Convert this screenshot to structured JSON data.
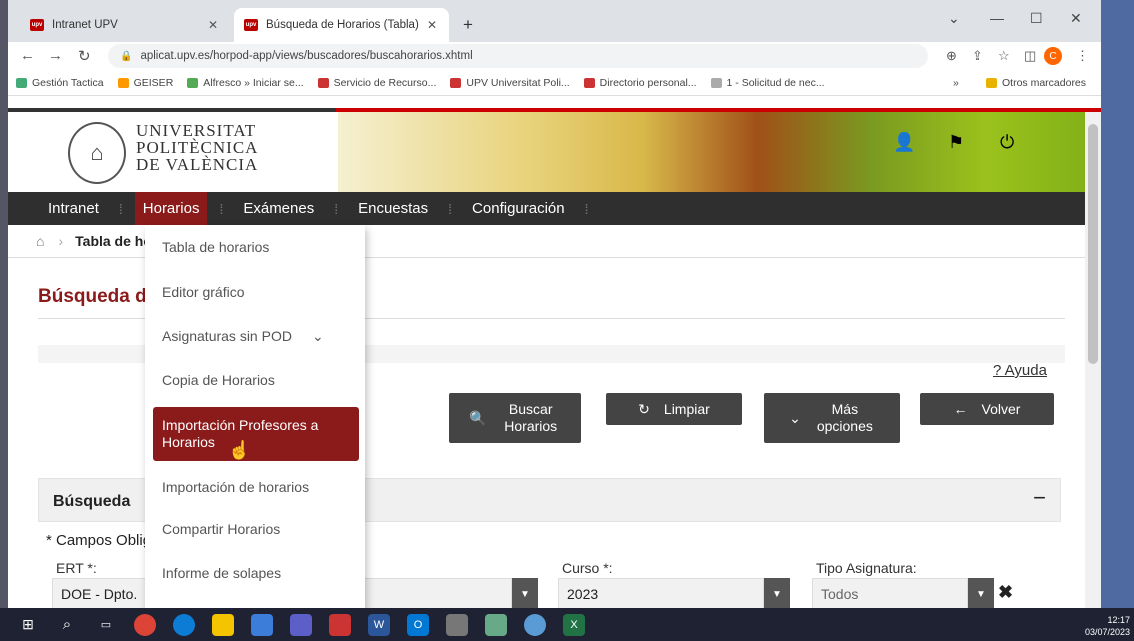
{
  "browser": {
    "tabs": [
      {
        "label": "Intranet UPV"
      },
      {
        "label": "Búsqueda de Horarios (Tabla)"
      }
    ],
    "url": "aplicat.upv.es/horpod-app/views/buscadores/buscahorarios.xhtml",
    "favicon_text": "upv",
    "profile_initial": "C"
  },
  "bookmarks": [
    {
      "label": "Gestión Tactica",
      "color": "#4a7"
    },
    {
      "label": "GEISER",
      "color": "#f90"
    },
    {
      "label": "Alfresco » Iniciar se...",
      "color": "#5a5"
    },
    {
      "label": "Servicio de Recurso...",
      "color": "#c33"
    },
    {
      "label": "UPV Universitat Poli...",
      "color": "#c33"
    },
    {
      "label": "Directorio personal...",
      "color": "#c33"
    },
    {
      "label": "1 - Solicitud de nec...",
      "color": "#aaa"
    }
  ],
  "bookmarks_more": "»",
  "bookmarks_other": "Otros marcadores",
  "header": {
    "line1": "UNIVERSITAT",
    "line2": "POLITÈCNICA",
    "line3": "DE VALÈNCIA"
  },
  "nav": {
    "items": [
      "Intranet",
      "Horarios",
      "Exámenes",
      "Encuestas",
      "Configuración"
    ],
    "active": "Horarios"
  },
  "breadcrumb": {
    "current": "Tabla de horarios"
  },
  "page": {
    "title": "Búsqueda de Horarios",
    "help": "? Ayuda"
  },
  "actions": {
    "buscar": "Buscar Horarios",
    "limpiar": "Limpiar",
    "mas": "Más opciones",
    "volver": "Volver"
  },
  "panel": {
    "title": "Búsqueda",
    "collapse": "−",
    "required_note": "* Campos Obligatorios"
  },
  "fields": [
    {
      "label": "ERT *:",
      "value": "DOE - Dpto."
    },
    {
      "label": "Curso *:",
      "value": "2023"
    },
    {
      "label": "Tipo Asignatura:",
      "value": "Todos"
    }
  ],
  "dropdown": {
    "items": [
      "Tabla de horarios",
      "Editor gráfico",
      "Asignaturas sin POD",
      "Copia de Horarios",
      "Importación Profesores a Horarios",
      "Importación de horarios",
      "Compartir Horarios",
      "Informe de solapes"
    ],
    "highlighted": "Importación Profesores a Horarios"
  },
  "taskbar": {
    "time": "12:17",
    "date": "03/07/2023"
  },
  "colors": {
    "brand": "#8b1a1a",
    "nav": "#2f2f2f",
    "button": "#444444"
  }
}
